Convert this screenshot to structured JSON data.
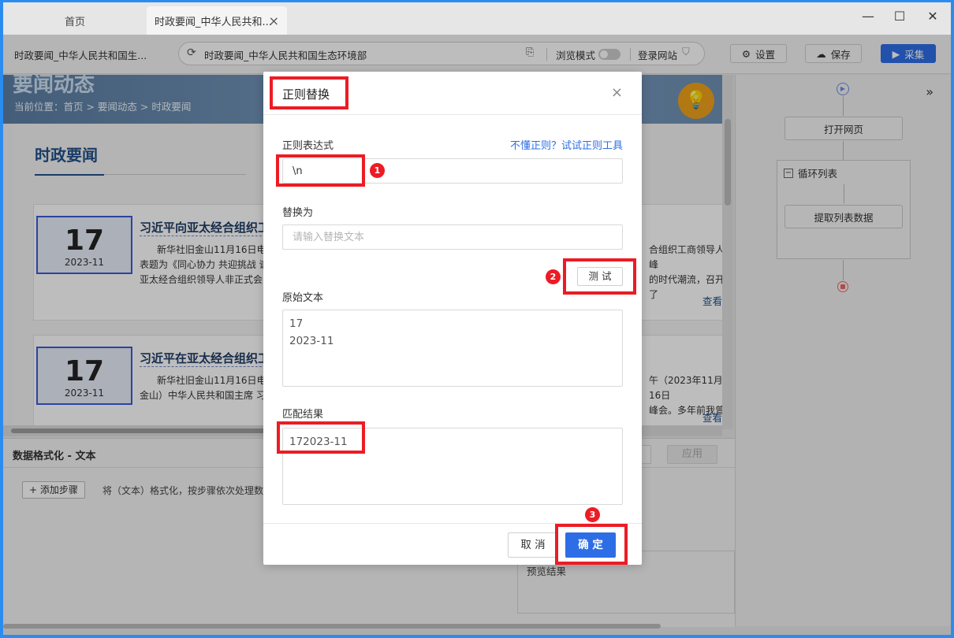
{
  "window": {
    "tabs": [
      {
        "label": "首页"
      },
      {
        "label": "时政要闻_中华人民共和..."
      }
    ],
    "close_tab_glyph": "×",
    "controls": {
      "minimize": "—",
      "maximize": "☐",
      "close": "✕"
    }
  },
  "toolbar": {
    "page_title": "时政要闻_中华人民共和国生...",
    "url": "时政要闻_中华人民共和国生态环境部",
    "browse_mode_label": "浏览模式",
    "login_site_label": "登录网站",
    "settings_label": "设置",
    "save_label": "保存",
    "collect_label": "采集"
  },
  "page": {
    "banner_heading": "要闻动态",
    "location": "当前位置：首页 > 要闻动态 > 时政要闻",
    "section_title": "时政要闻",
    "cards": [
      {
        "day": "17",
        "year_month": "2023-11",
        "title": "习近平向亚太经合组织工",
        "body_line1": "新华社旧金山11月16日电",
        "body_line2": "表题为《同心协力 共迎挑战 谱",
        "body_line3": "亚太经合组织领导人非正式会",
        "right_line1": "合组织工商领导人峰",
        "right_line2": "的时代潮流，召开了",
        "more": "查看"
      },
      {
        "day": "17",
        "year_month": "2023-11",
        "title": "习近平在亚太经合组织工",
        "body_line1": "新华社旧金山11月16日电",
        "body_line2": "金山）中华人民共和国主席 习",
        "right_line1": "午（2023年11月16日",
        "right_line2": "峰会。多年前我曾",
        "more": "查看"
      }
    ]
  },
  "flow": {
    "collapse_glyph": "»",
    "nodes": {
      "open_page": "打开网页",
      "loop_list": "循环列表",
      "extract_list": "提取列表数据"
    }
  },
  "bottom_panel": {
    "title": "数据格式化 - 文本",
    "add_step": "+ 添加步骤",
    "description": "将（文本）格式化，按步骤依次处理数",
    "apply": "应用",
    "preview_label": "预览结果"
  },
  "dialog": {
    "title": "正则替换",
    "close_glyph": "×",
    "regex_label": "正则表达式",
    "regex_help_link": "不懂正则？试试正则工具",
    "regex_value": "\\n",
    "replace_label": "替换为",
    "replace_placeholder": "请输入替换文本",
    "test_button": "测 试",
    "original_label": "原始文本",
    "original_text": "17\n2023-11",
    "result_label": "匹配结果",
    "result_text": "172023-11",
    "cancel_button": "取 消",
    "ok_button": "确 定"
  },
  "annotations": {
    "steps": [
      "1",
      "2",
      "3"
    ],
    "highlight_color": "#ec1c24"
  },
  "colors": {
    "primary": "#2d6ee6",
    "annotation": "#ec1c24",
    "window_border": "#2b8cf0"
  }
}
